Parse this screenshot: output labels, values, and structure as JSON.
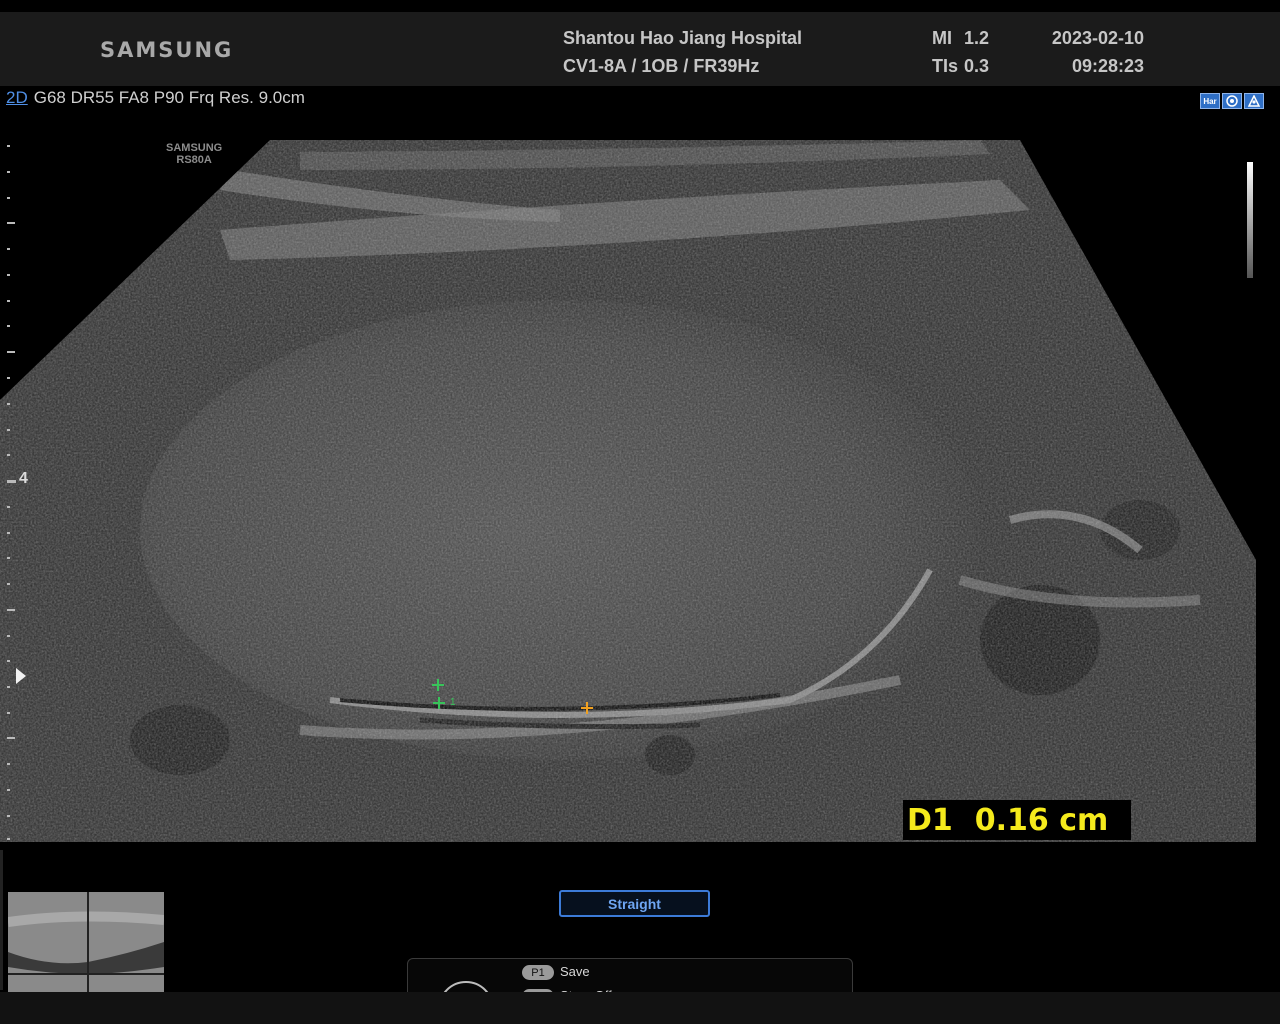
{
  "header": {
    "brand": "SAMSUNG",
    "hospital": "Shantou Hao Jiang Hospital",
    "probe_info": "CV1-8A / 1OB / FR39Hz",
    "mi_label": "MI",
    "mi_value": "1.2",
    "tis_label": "TIs",
    "tis_value": "0.3",
    "date": "2023-02-10",
    "time": "09:28:23"
  },
  "imaging": {
    "mode": "2D",
    "params": "G68 DR55 FA8 P90 Frq Res. 9.0cm",
    "watermark_line1": "SAMSUNG",
    "watermark_line2": "RS80A",
    "depth_label": "4",
    "status_icons": [
      {
        "name": "harmonic-icon",
        "text": "Har"
      },
      {
        "name": "fetus-icon",
        "text": ""
      },
      {
        "name": "preset-icon",
        "text": ""
      }
    ]
  },
  "measurement": {
    "label": "D1",
    "value": "0.16 cm",
    "caliper_number": "1",
    "color": "#f5ea1c"
  },
  "controls": {
    "mode_button": "Straight",
    "p1_key": "P1",
    "p1_label": "Save",
    "p2_label": "Store Off"
  },
  "colors": {
    "accent": "#3c7bd8",
    "caliper_start": "#38c45a",
    "caliper_end": "#f0a020"
  }
}
